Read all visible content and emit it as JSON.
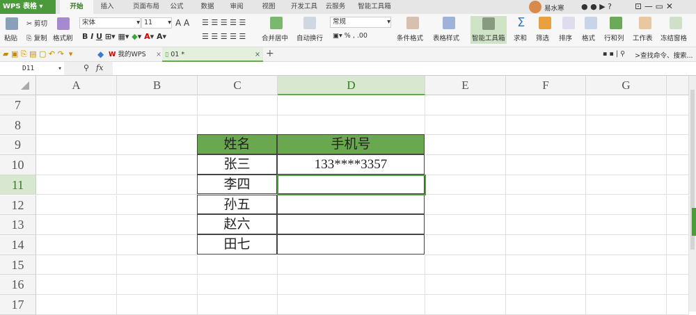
{
  "app": {
    "logo": "WPS 表格"
  },
  "tabs": [
    "开始",
    "插入",
    "页面布局",
    "公式",
    "数据",
    "审阅",
    "视图",
    "开发工具",
    "云服务",
    "智能工具箱"
  ],
  "user": {
    "name": "易水寒"
  },
  "ribbon": {
    "paste": "粘贴",
    "cut": "剪切",
    "copy": "复制",
    "format_painter": "格式刷",
    "font": "宋体",
    "size": "11",
    "merge": "合并居中",
    "wrap": "自动换行",
    "number_format": "常规",
    "percent": "%",
    "cond_format": "条件格式",
    "table_style": "表格样式",
    "smart_toolbox": "智能工具箱",
    "sum": "求和",
    "filter": "筛选",
    "sort": "排序",
    "format": "格式",
    "rows_cols": "行和列",
    "worksheet": "工作表",
    "freeze": "冻结窗格"
  },
  "doc_tabs": [
    {
      "label": "我的WPS"
    },
    {
      "label": "01 *"
    }
  ],
  "search": {
    "placeholder": ">查找命令、搜索..."
  },
  "formula": {
    "name_box": "D11",
    "fx": "fx",
    "value": ""
  },
  "columns": [
    "A",
    "B",
    "C",
    "D",
    "E",
    "F",
    "G"
  ],
  "rows": [
    "7",
    "8",
    "9",
    "10",
    "11",
    "12",
    "13",
    "14",
    "15",
    "16",
    "17"
  ],
  "selected": {
    "col": "D",
    "row": "11"
  },
  "table": {
    "headers": [
      "姓名",
      "手机号"
    ],
    "rows": [
      [
        "张三",
        "133****3357"
      ],
      [
        "李四",
        ""
      ],
      [
        "孙五",
        ""
      ],
      [
        "赵六",
        ""
      ],
      [
        "田七",
        ""
      ]
    ]
  },
  "colors": {
    "accent": "#4a9a3c",
    "header_fill": "#6aa84f"
  }
}
